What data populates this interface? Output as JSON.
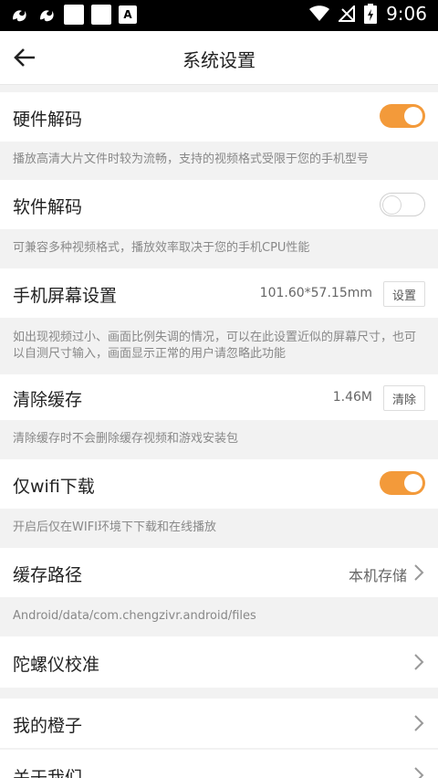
{
  "status_bar": {
    "time": "9:06",
    "a_badge": "A"
  },
  "header": {
    "title": "系统设置"
  },
  "settings": {
    "hardware_decode": {
      "label": "硬件解码",
      "enabled": true,
      "hint": "播放高清大片文件时较为流畅，支持的视频格式受限于您的手机型号"
    },
    "software_decode": {
      "label": "软件解码",
      "enabled": false,
      "hint": "可兼容多种视频格式，播放效率取决于您的手机CPU性能"
    },
    "screen": {
      "label": "手机屏幕设置",
      "value": "101.60*57.15mm",
      "button": "设置",
      "hint": "如出现视频过小、画面比例失调的情况，可以在此设置近似的屏幕尺寸，也可以自测尺寸输入，画面显示正常的用户请忽略此功能"
    },
    "cache": {
      "label": "清除缓存",
      "value": "1.46M",
      "button": "清除",
      "hint": "清除缓存时不会删除缓存视频和游戏安装包"
    },
    "wifi_only": {
      "label": "仅wifi下载",
      "enabled": true,
      "hint": "开启后仅在WIFI环境下下载和在线播放"
    },
    "cache_path": {
      "label": "缓存路径",
      "value": "本机存储",
      "hint": "Android/data/com.chengzivr.android/files"
    },
    "gyro": {
      "label": "陀螺仪校准"
    },
    "my_orange": {
      "label": "我的橙子"
    },
    "about": {
      "label": "关于我们"
    }
  },
  "colors": {
    "accent": "#f39a3a",
    "background": "#f2f2f2"
  }
}
